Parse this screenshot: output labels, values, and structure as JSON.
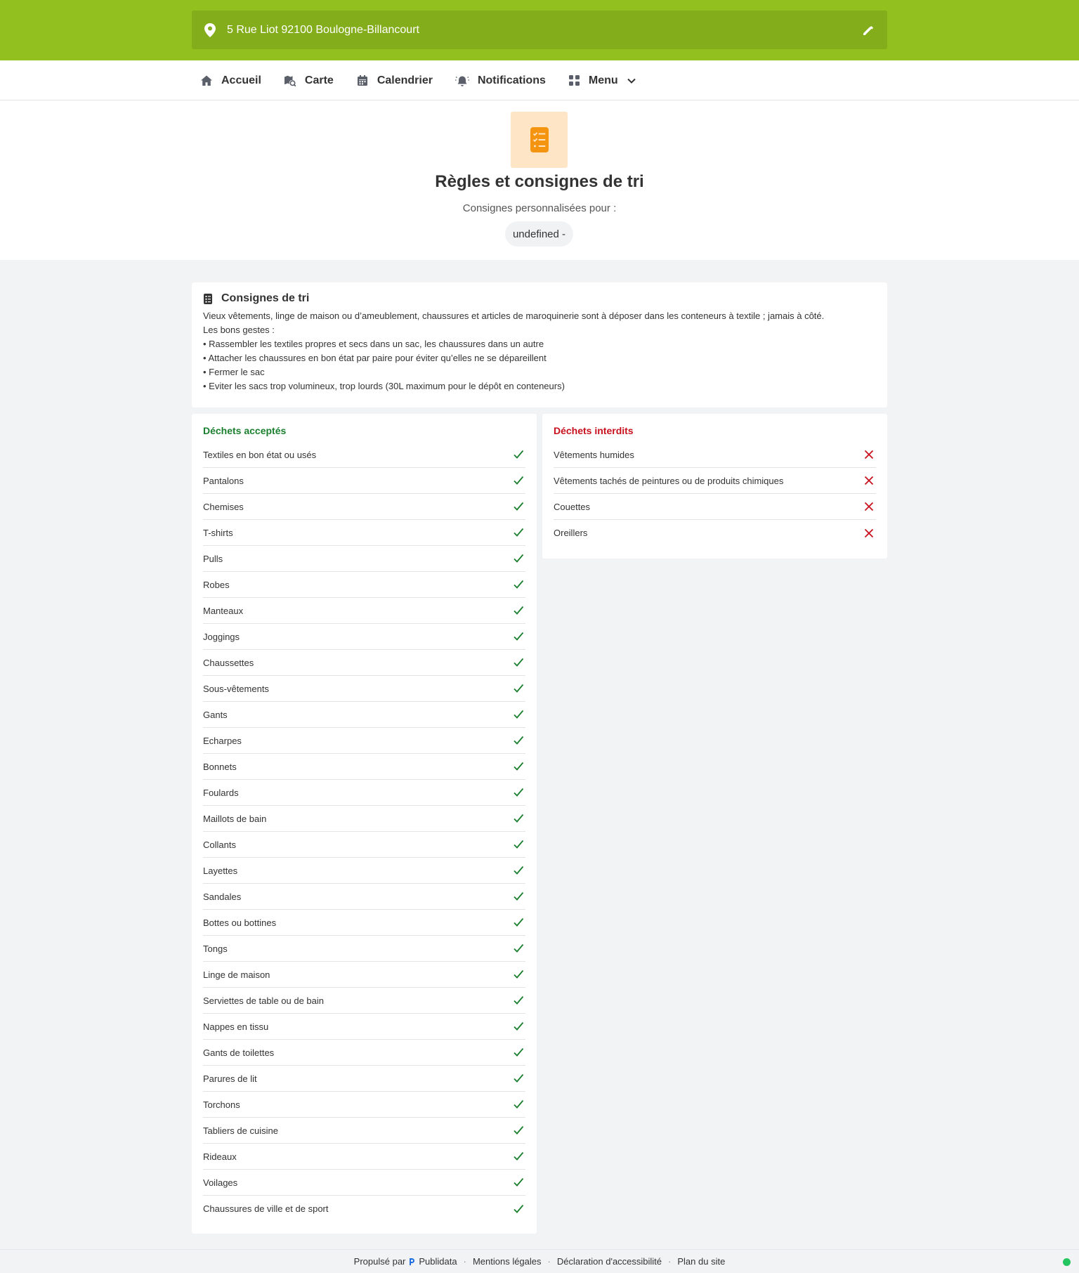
{
  "header": {
    "address": "5 Rue Liot 92100 Boulogne-Billancourt",
    "brand_color": "#92c01f"
  },
  "nav": {
    "items": [
      {
        "label": "Accueil",
        "icon": "home-icon"
      },
      {
        "label": "Carte",
        "icon": "map-icon"
      },
      {
        "label": "Calendrier",
        "icon": "calendar-icon"
      },
      {
        "label": "Notifications",
        "icon": "bell-icon"
      },
      {
        "label": "Menu",
        "icon": "grid-icon"
      }
    ]
  },
  "hero": {
    "title": "Règles et consignes de tri",
    "subtitle": "Consignes personnalisées pour :",
    "pill": "undefined -"
  },
  "consignes": {
    "title": "Consignes de tri",
    "lines": [
      "Vieux vêtements, linge de maison ou d’ameublement, chaussures et articles de maroquinerie sont à déposer dans les conteneurs à textile ; jamais à côté.",
      "Les bons gestes :",
      "• Rassembler les textiles propres et secs dans un sac, les chaussures dans un autre",
      "• Attacher les chaussures en bon état par paire pour éviter qu’elles ne se dépareillent",
      "• Fermer le sac",
      "• Eviter les sacs trop volumineux, trop lourds (30L maximum pour le dépôt en conteneurs)"
    ]
  },
  "accepted": {
    "title": "Déchets acceptés",
    "color": "#1a7f2e",
    "items": [
      "Textiles en bon état ou usés",
      "Pantalons",
      "Chemises",
      "T-shirts",
      "Pulls",
      "Robes",
      "Manteaux",
      "Joggings",
      "Chaussettes",
      "Sous-vêtements",
      "Gants",
      "Echarpes",
      "Bonnets",
      "Foulards",
      "Maillots de bain",
      "Collants",
      "Layettes",
      "Sandales",
      "Bottes ou bottines",
      "Tongs",
      "Linge de maison",
      "Serviettes de table ou de bain",
      "Nappes en tissu",
      "Gants de toilettes",
      "Parures de lit",
      "Torchons",
      "Tabliers de cuisine",
      "Rideaux",
      "Voilages",
      "Chaussures de ville et de sport"
    ]
  },
  "forbidden": {
    "title": "Déchets interdits",
    "color": "#c8101e",
    "items": [
      "Vêtements humides",
      "Vêtements tachés de peintures ou de produits chimiques",
      "Couettes",
      "Oreillers"
    ]
  },
  "footer": {
    "powered_by": "Propulsé par",
    "brand": "Publidata",
    "links": [
      "Mentions légales",
      "Déclaration d'accessibilité",
      "Plan du site"
    ]
  }
}
